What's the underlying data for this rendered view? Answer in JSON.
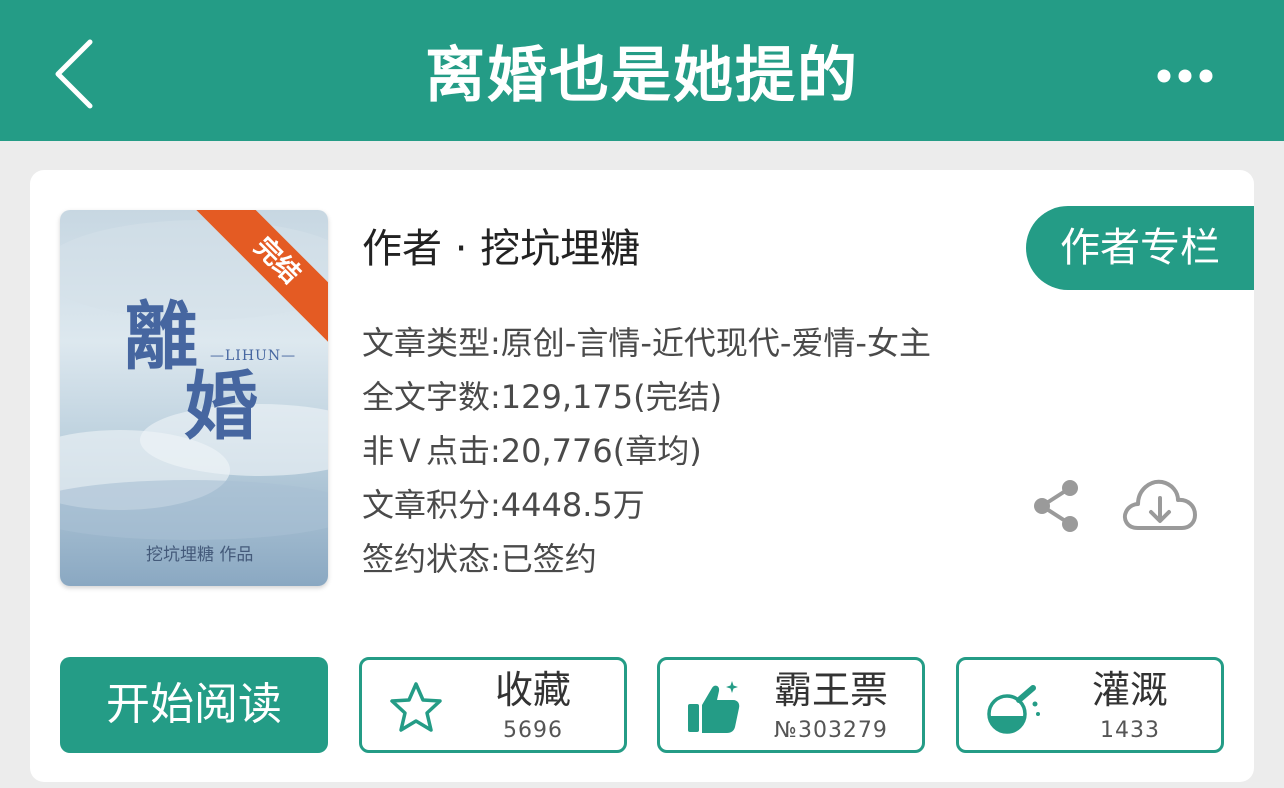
{
  "header": {
    "title": "离婚也是她提的",
    "back_icon": "chevron-left-icon",
    "more_icon": "more-dots-icon"
  },
  "book": {
    "cover": {
      "title_char_1": "離",
      "title_char_2": "婚",
      "subtitle": "—LIHUN—",
      "author_caption": "挖坑埋糖  作品",
      "status_ribbon": "完结"
    },
    "author_line": "作者 · 挖坑埋糖",
    "author_column_label": "作者专栏",
    "info": [
      "文章类型:原创-言情-近代现代-爱情-女主",
      "全文字数:129,175(完结)",
      "非Ｖ点击:20,776(章均)",
      "文章积分:4448.5万",
      "签约状态:已签约"
    ]
  },
  "actions": {
    "read_label": "开始阅读",
    "favorite": {
      "label": "收藏",
      "count": "5696",
      "icon": "star-icon"
    },
    "vote": {
      "label": "霸王票",
      "count": "№303279",
      "icon": "thumbs-up-icon"
    },
    "water": {
      "label": "灌溉",
      "count": "1433",
      "icon": "flask-icon"
    }
  },
  "colors": {
    "brand": "#249c86",
    "ribbon": "#e45b23",
    "background": "#ececec"
  }
}
